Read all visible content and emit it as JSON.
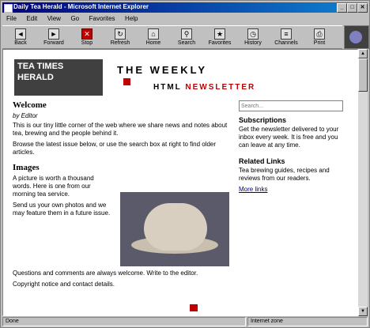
{
  "window": {
    "title": "Daily Tea Herald - Microsoft Internet Explorer"
  },
  "menu": [
    "File",
    "Edit",
    "View",
    "Go",
    "Favorites",
    "Help"
  ],
  "toolbar": [
    {
      "label": "Back",
      "icon": "back-arrow-icon",
      "glyph": "◄"
    },
    {
      "label": "Forward",
      "icon": "forward-arrow-icon",
      "glyph": "►"
    },
    {
      "label": "Stop",
      "icon": "stop-icon",
      "glyph": "✕",
      "red": true
    },
    {
      "label": "Refresh",
      "icon": "refresh-icon",
      "glyph": "↻"
    },
    {
      "label": "Home",
      "icon": "home-icon",
      "glyph": "⌂"
    },
    {
      "label": "Search",
      "icon": "search-icon",
      "glyph": "⚲"
    },
    {
      "label": "Favorites",
      "icon": "favorites-icon",
      "glyph": "★"
    },
    {
      "label": "History",
      "icon": "history-icon",
      "glyph": "◷"
    },
    {
      "label": "Channels",
      "icon": "channels-icon",
      "glyph": "≡"
    },
    {
      "label": "Print",
      "icon": "print-icon",
      "glyph": "⎙"
    }
  ],
  "page": {
    "logo_text": "TEA TIMES HERALD",
    "masthead": "THE WEEKLY",
    "edition_label": "HTML",
    "edition_value": "NEWSLETTER",
    "intro_heading": "Welcome",
    "intro_byline": "by Editor",
    "intro_paragraphs": [
      "This is our tiny little corner of the web where we share news and notes about tea, brewing and the people behind it.",
      "Browse the latest issue below, or use the search box at right to find older articles."
    ],
    "story_heading": "Images",
    "story_paragraphs": [
      "A picture is worth a thousand words. Here is one from our morning tea service.",
      "Send us your own photos and we may feature them in a future issue."
    ],
    "sidebar": {
      "search_placeholder": "Search...",
      "heading1": "Subscriptions",
      "text1": "Get the newsletter delivered to your inbox every week. It is free and you can leave at any time.",
      "heading2": "Related Links",
      "text2": "Tea brewing guides, recipes and reviews from our readers.",
      "link": "More links"
    },
    "footer_paragraphs": [
      "Questions and comments are always welcome. Write to the editor.",
      "Copyright notice and contact details."
    ]
  },
  "status": {
    "left": "Done",
    "right": "Internet zone"
  }
}
